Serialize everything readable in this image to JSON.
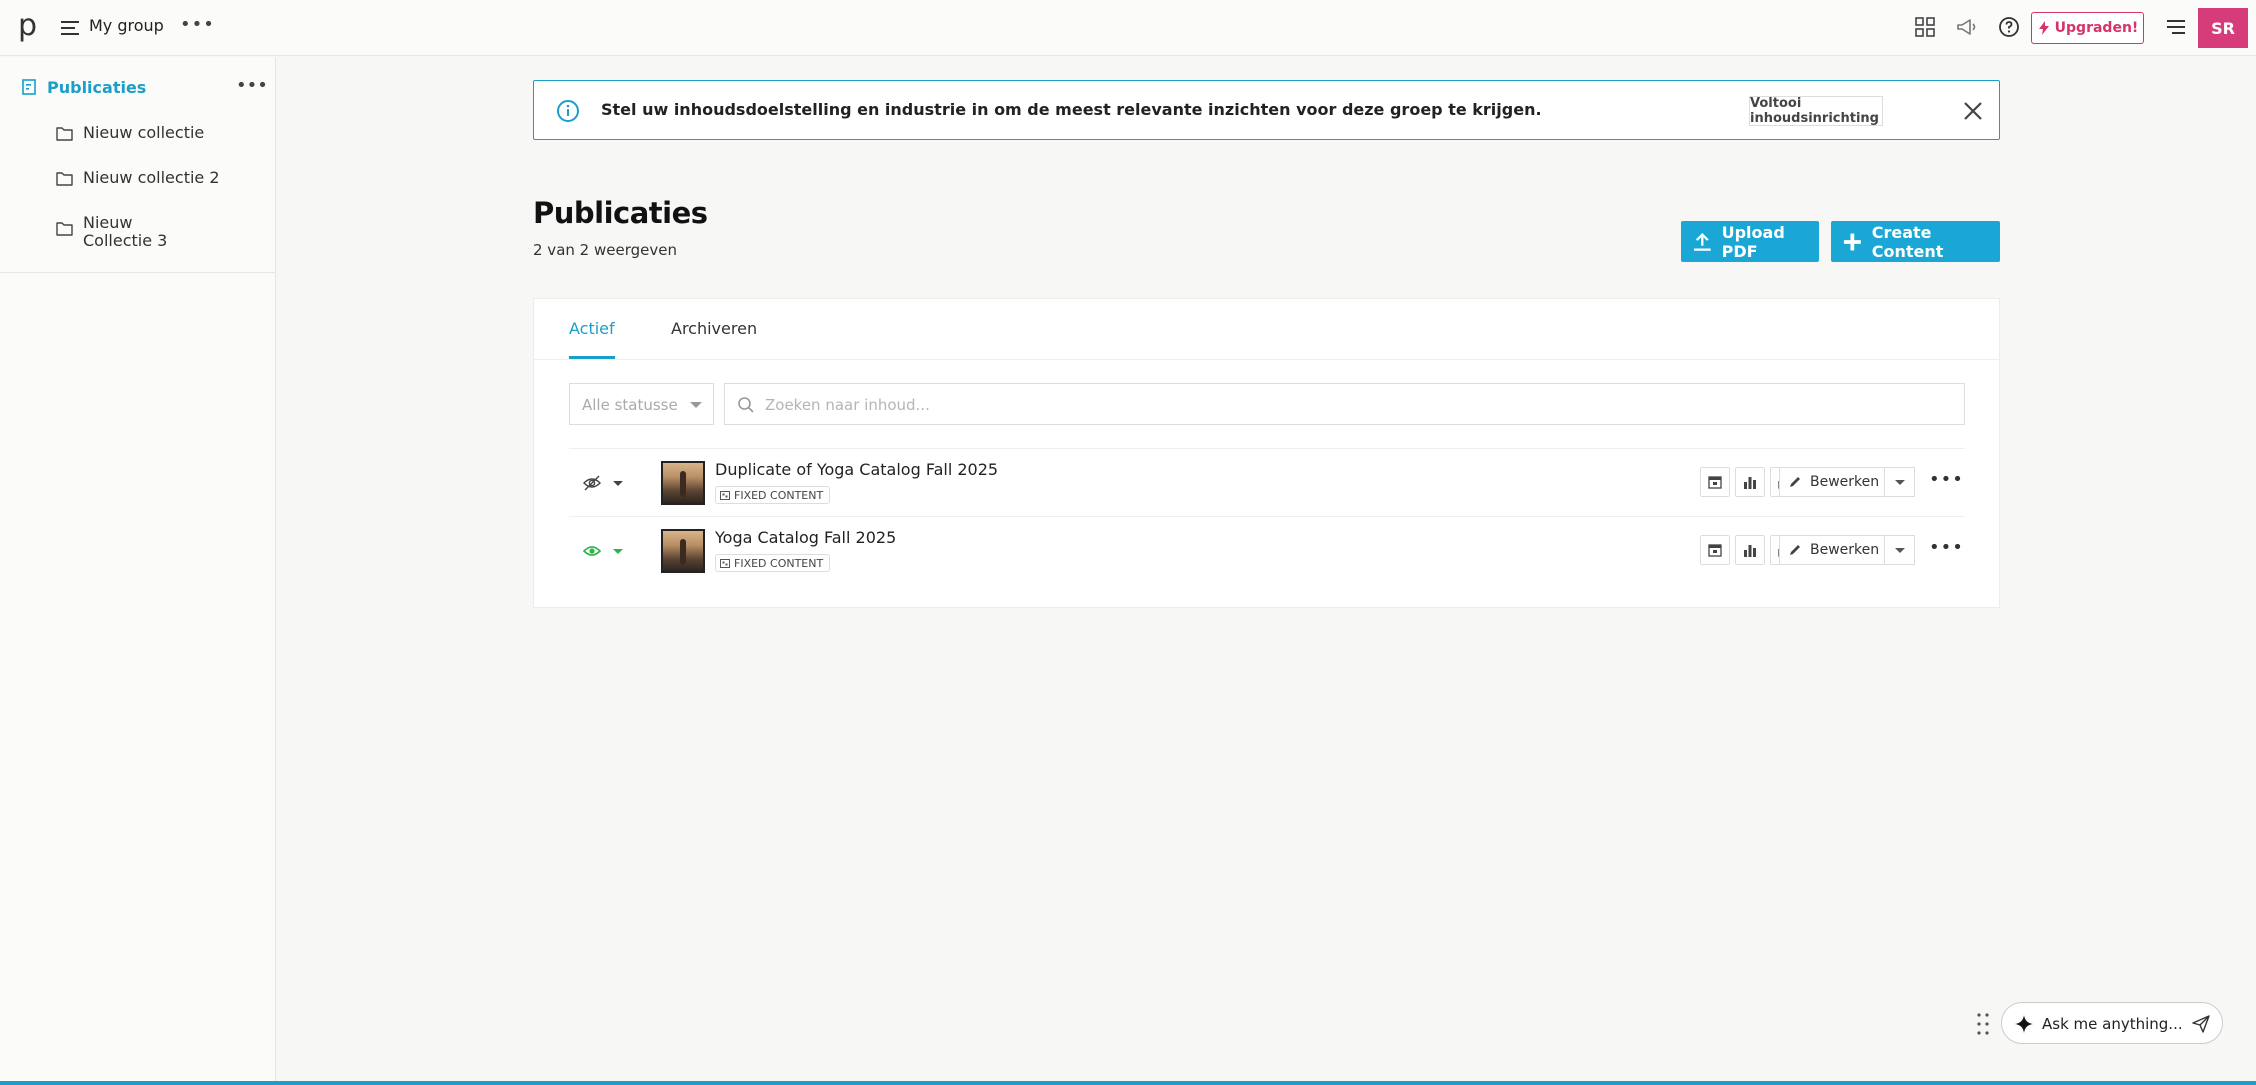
{
  "topbar": {
    "logo": "p",
    "group_name": "My group",
    "group_more": "•••",
    "upgrade_label": "Upgraden!",
    "avatar_initials": "SR",
    "icons": [
      "apps-grid-icon",
      "megaphone-icon",
      "help-icon",
      "menu-icon"
    ]
  },
  "sidebar": {
    "header_label": "Publicaties",
    "header_more": "•••",
    "items": [
      {
        "label": "Nieuw collectie"
      },
      {
        "label": "Nieuw collectie 2"
      },
      {
        "label": "Nieuw Collectie 3"
      }
    ]
  },
  "banner": {
    "message": "Stel uw inhoudsdoelstelling en industrie in om de meest relevante inzichten voor deze groep te krijgen.",
    "action_label": "Voltooi inhoudsinrichting"
  },
  "main": {
    "title": "Publicaties",
    "count_text": "2 van 2 weergeven",
    "upload_label": "Upload PDF",
    "create_label": "Create Content",
    "tabs": [
      {
        "label": "Actief",
        "active": true
      },
      {
        "label": "Archiveren",
        "active": false
      }
    ],
    "status_select_value": "Alle statusse",
    "search_placeholder": "Zoeken naar inhoud...",
    "rows": [
      {
        "title": "Duplicate of Yoga Catalog Fall 2025",
        "badge": "FIXED CONTENT",
        "visibility": "hidden",
        "edit_label": "Bewerken",
        "more": "•••"
      },
      {
        "title": "Yoga Catalog Fall 2025",
        "badge": "FIXED CONTENT",
        "visibility": "visible",
        "edit_label": "Bewerken",
        "more": "•••"
      }
    ]
  },
  "ask": {
    "placeholder_text": "Ask me anything..."
  },
  "colors": {
    "accent": "#1a9fc9",
    "primary_button": "#1aa7d6",
    "upgrade": "#d6336c",
    "avatar": "#d63c7a",
    "visible_green": "#2db34a"
  }
}
